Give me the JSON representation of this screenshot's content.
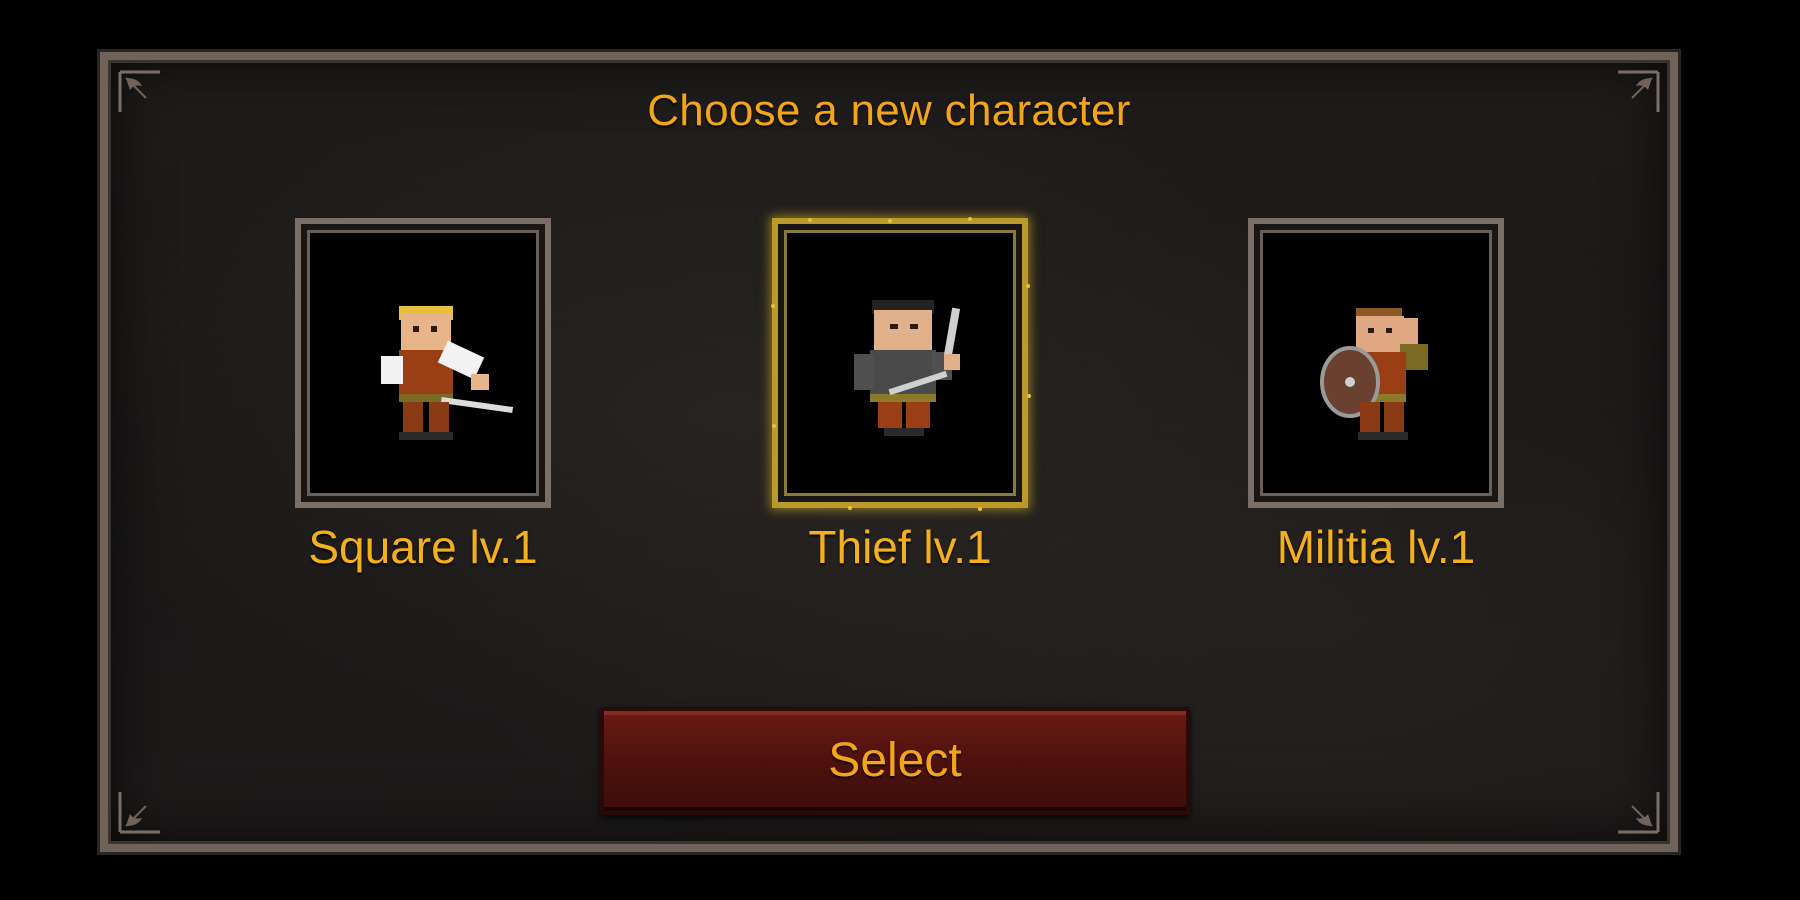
{
  "dialog": {
    "title": "Choose a new character"
  },
  "characters": [
    {
      "label": "Square lv.1",
      "icon": "square-knight-icon",
      "selected": false
    },
    {
      "label": "Thief lv.1",
      "icon": "thief-icon",
      "selected": true
    },
    {
      "label": "Militia lv.1",
      "icon": "militia-icon",
      "selected": false
    }
  ],
  "actions": {
    "select_label": "Select"
  },
  "colors": {
    "accent_text": "#f2a516",
    "button_bg": "#5a1510",
    "frame": "#6e625b",
    "selected_frame": "#b99a2a",
    "panel_bg": "#1c1a19"
  }
}
